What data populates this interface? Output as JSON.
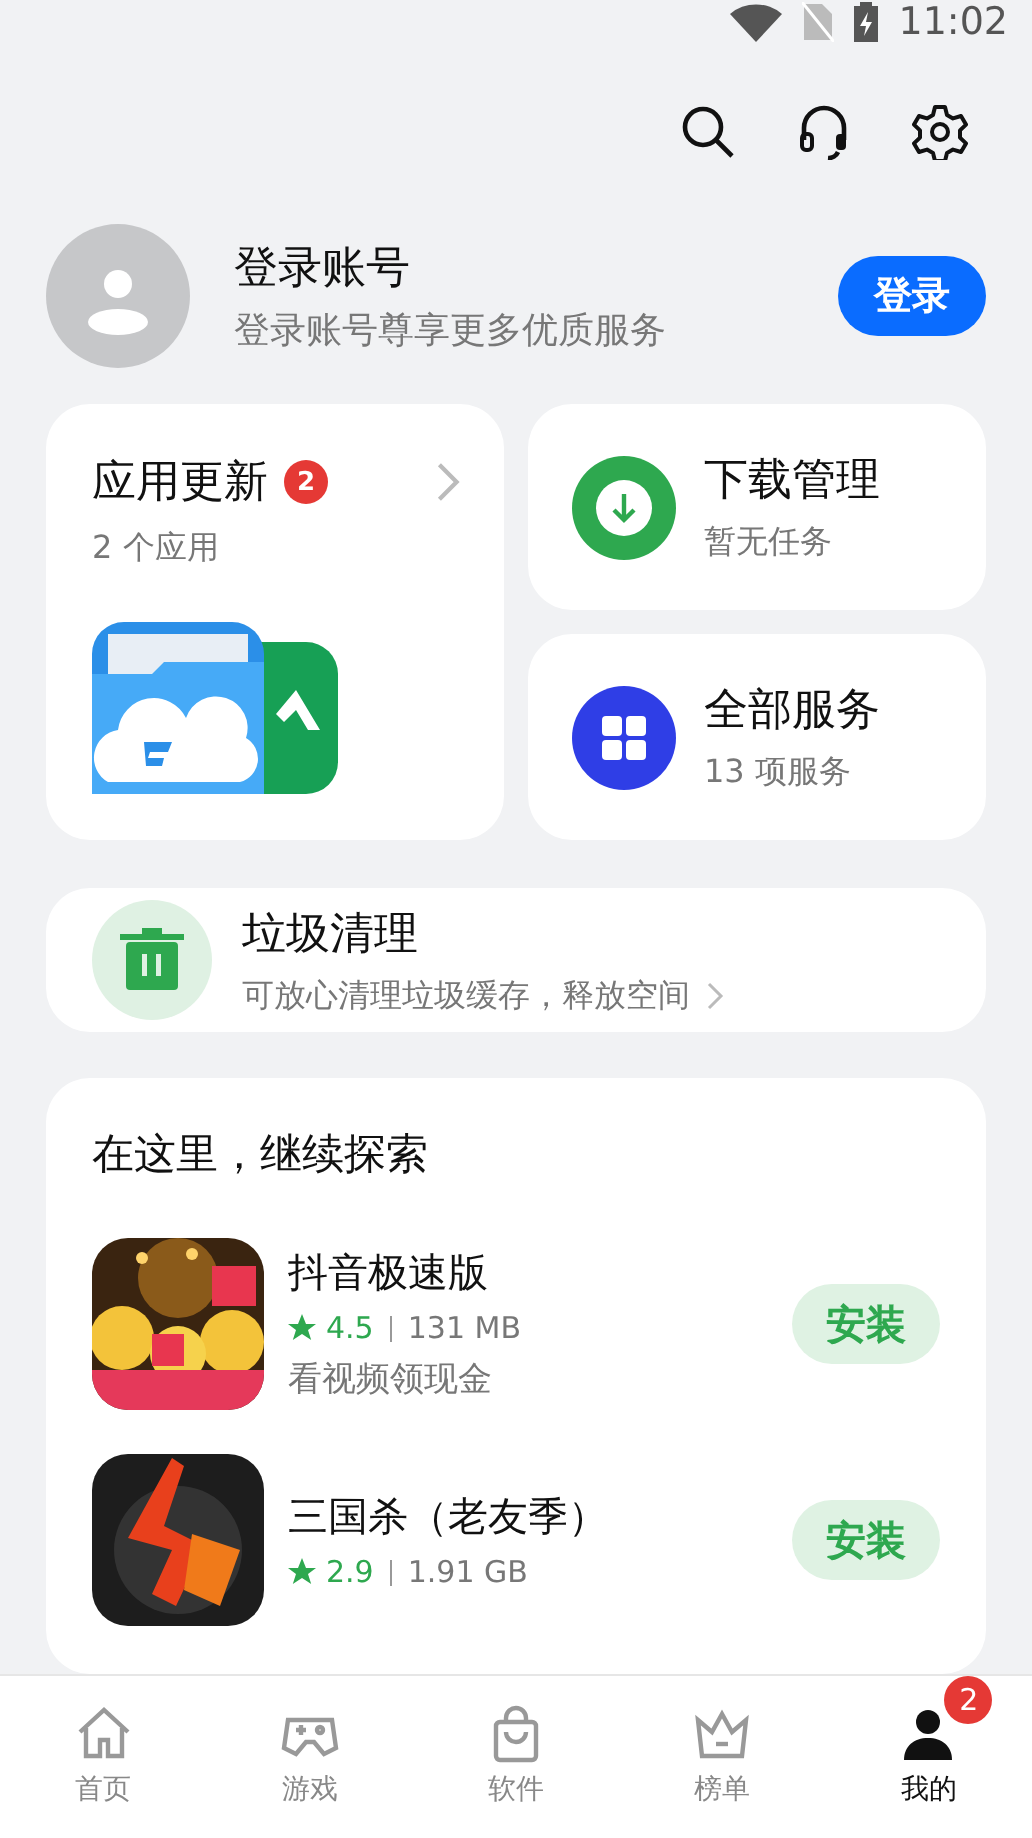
{
  "status_bar": {
    "time": "11:02"
  },
  "account": {
    "title": "登录账号",
    "subtitle": "登录账号尊享更多优质服务",
    "login_button": "登录"
  },
  "updates": {
    "title": "应用更新",
    "badge": "2",
    "subtitle": "2 个应用"
  },
  "download": {
    "title": "下载管理",
    "subtitle": "暂无任务"
  },
  "services": {
    "title": "全部服务",
    "subtitle": "13 项服务"
  },
  "cleanup": {
    "title": "垃圾清理",
    "subtitle": "可放心清理垃圾缓存，释放空间"
  },
  "explore": {
    "title": "在这里，继续探索",
    "apps": [
      {
        "name": "抖音极速版",
        "rating": "4.5",
        "size": "131 MB",
        "description": "看视频领现金",
        "button": "安装"
      },
      {
        "name": "三国杀（老友季）",
        "rating": "2.9",
        "size": "1.91 GB",
        "button": "安装"
      }
    ]
  },
  "nav": {
    "items": [
      {
        "label": "首页",
        "selected": false
      },
      {
        "label": "游戏",
        "selected": false
      },
      {
        "label": "软件",
        "selected": false
      },
      {
        "label": "榜单",
        "selected": false
      },
      {
        "label": "我的",
        "selected": true,
        "badge": "2"
      }
    ]
  }
}
